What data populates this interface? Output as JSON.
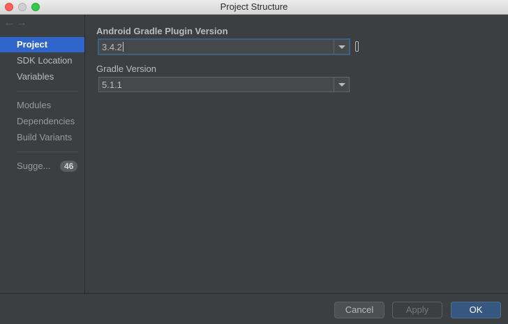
{
  "window": {
    "title": "Project Structure"
  },
  "sidebar": {
    "nav": {
      "back": "←",
      "forward": "→"
    },
    "group1": [
      {
        "label": "Project",
        "selected": true
      },
      {
        "label": "SDK Location"
      },
      {
        "label": "Variables"
      }
    ],
    "group2": [
      {
        "label": "Modules"
      },
      {
        "label": "Dependencies"
      },
      {
        "label": "Build Variants"
      }
    ],
    "suggestions": {
      "label": "Sugge...",
      "count": "46"
    }
  },
  "main": {
    "agp": {
      "label": "Android Gradle Plugin Version",
      "value": "3.4.2"
    },
    "gradle": {
      "label": "Gradle Version",
      "value": "5.1.1"
    }
  },
  "footer": {
    "cancel": "Cancel",
    "apply": "Apply",
    "ok": "OK"
  },
  "colors": {
    "accent": "#2f65ca",
    "ok_button": "#365880",
    "focus_border": "#3d6185"
  }
}
